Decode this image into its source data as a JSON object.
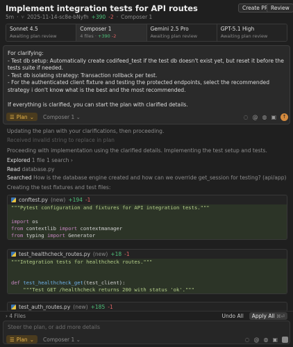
{
  "header": {
    "title": "Implement integration tests for API routes",
    "age": "5m",
    "branch": "2025-11-14-sc8e-bNyfh",
    "additions": "+390",
    "deletions": "-2",
    "composer": "Composer 1",
    "create_pr_label": "Create PR",
    "review_label": "Review"
  },
  "tabs": [
    {
      "name": "Sonnet 4.5",
      "sub": "Awaiting plan review"
    },
    {
      "name": "Composer 1",
      "files": "4 files",
      "additions": "+390",
      "deletions": "-2"
    },
    {
      "name": "Gemini 2.5 Pro",
      "sub": "Awaiting plan review"
    },
    {
      "name": "GPT-5.1 High",
      "sub": "Awaiting plan review"
    }
  ],
  "prompt": {
    "text": "For clarifying:\n- Test db setup: Automatically create codifeed_test if the test db doesn't exist yet, but reset it before the tests suite if needed.\n- Test db isolating strategy: Transaction rollback per test.\n- For the authenticated client fixture and testing the protected endpoints, select the recommended strategy i don't know what is the best and the most recommended.\n\nIf everything is clarified, you can start the plan with clarified details.",
    "mode": "Plan",
    "model": "Composer 1"
  },
  "conversation": {
    "line1": "Updating the plan with your clarifications, then proceeding.",
    "line2": "Received invalid string to replace in plan",
    "line3": "Proceeding with implementation using the clarified details. Implementing the test setup and tests.",
    "explored_label": "Explored",
    "explored_detail": "1 file 1 search",
    "read_label": "Read",
    "read_file": "database.py",
    "searched_label": "Searched",
    "searched_detail": "How is the database engine created and how can we override get_session for testing? (api/app)",
    "creating": "Creating the test fixtures and test files:"
  },
  "files": [
    {
      "name": "conftest.py",
      "status": "(new)",
      "additions": "+194",
      "deletions": "-1",
      "lines": [
        {
          "parts": [
            {
              "c": "str",
              "t": "\"\"\"Pytest configuration and fixtures for API integration tests.\"\"\""
            }
          ]
        },
        {
          "parts": []
        },
        {
          "parts": [
            {
              "c": "kw",
              "t": "import"
            },
            {
              "c": "tx",
              "t": " os"
            }
          ]
        },
        {
          "parts": [
            {
              "c": "kw",
              "t": "from"
            },
            {
              "c": "tx",
              "t": " contextlib "
            },
            {
              "c": "kw",
              "t": "import"
            },
            {
              "c": "tx",
              "t": " contextmanager"
            }
          ]
        },
        {
          "parts": [
            {
              "c": "kw",
              "t": "from"
            },
            {
              "c": "tx",
              "t": " typing "
            },
            {
              "c": "kw",
              "t": "import"
            },
            {
              "c": "tx",
              "t": " Generator"
            }
          ]
        }
      ]
    },
    {
      "name": "test_healthcheck_routes.py",
      "status": "(new)",
      "additions": "+18",
      "deletions": "-1",
      "lines": [
        {
          "parts": [
            {
              "c": "str",
              "t": "\"\"\"Integration tests for healthcheck routes.\"\"\""
            }
          ]
        },
        {
          "parts": []
        },
        {
          "parts": []
        },
        {
          "parts": [
            {
              "c": "kw",
              "t": "def"
            },
            {
              "c": "tx",
              "t": " "
            },
            {
              "c": "fn",
              "t": "test_healthcheck_get"
            },
            {
              "c": "tx",
              "t": "(test_client):"
            }
          ]
        },
        {
          "parts": [
            {
              "c": "str",
              "t": "    \"\"\"Test GET /healthcheck returns 200 with status 'ok'.\"\"\""
            }
          ]
        }
      ]
    },
    {
      "name": "test_auth_routes.py",
      "status": "(new)",
      "additions": "+185",
      "deletions": "-1"
    }
  ],
  "footer": {
    "files_count": "4 Files",
    "undo_all": "Undo All",
    "apply_all": "Apply All",
    "apply_shortcut": "⌘⏎",
    "placeholder": "Steer the plan, or add more details",
    "mode": "Plan",
    "model": "Composer 1"
  }
}
